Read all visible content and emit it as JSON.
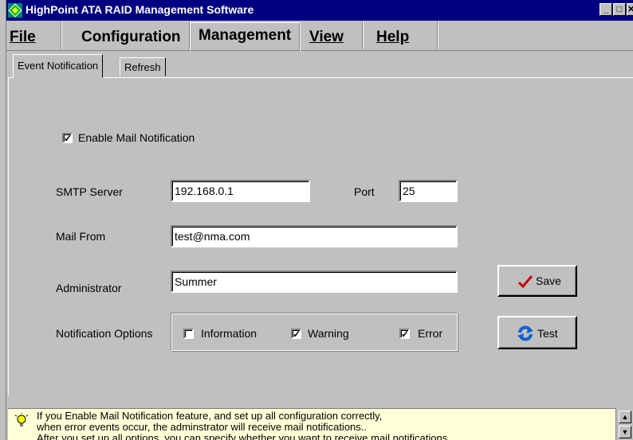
{
  "window": {
    "title": "HighPoint ATA RAID Management Software",
    "minimize_glyph": "_",
    "maximize_glyph": "□",
    "close_glyph": "✕"
  },
  "menu": {
    "file": "File",
    "configuration": "Configuration",
    "management": "Management",
    "view": "View",
    "help": "Help"
  },
  "tabs": {
    "event_notification": "Event Notification",
    "refresh": "Refresh"
  },
  "form": {
    "enable_mail_label": "Enable Mail Notification",
    "enable_mail_checked": true,
    "smtp_label": "SMTP Server",
    "smtp_value": "192.168.0.1",
    "port_label": "Port",
    "port_value": "25",
    "mail_from_label": "Mail From",
    "mail_from_value": "test@nma.com",
    "administrator_label": "Administrator",
    "administrator_value": "Summer",
    "notification_options_label": "Notification Options",
    "opt_information": "Information",
    "opt_information_checked": false,
    "opt_warning": "Warning",
    "opt_warning_checked": true,
    "opt_error": "Error",
    "opt_error_checked": true,
    "save_label": "Save",
    "test_label": "Test"
  },
  "hint": {
    "line1": "If you Enable Mail Notification feature, and set up all configuration correctly,",
    "line2": "when error events occur, the adminstrator will receive mail notifications..",
    "line3": "After you set up all options, you can specify whether you want to receive mail notifications"
  },
  "icons": {
    "app": "app-diamond-icon",
    "save": "checkmark-icon",
    "test": "refresh-arrows-icon",
    "hint": "lightbulb-icon"
  },
  "colors": {
    "titlebar": "#000080",
    "face": "#c0c0c0",
    "hint_background": "#ffffd8",
    "save_check": "#cc0000",
    "test_arrows": "#1060d0"
  }
}
